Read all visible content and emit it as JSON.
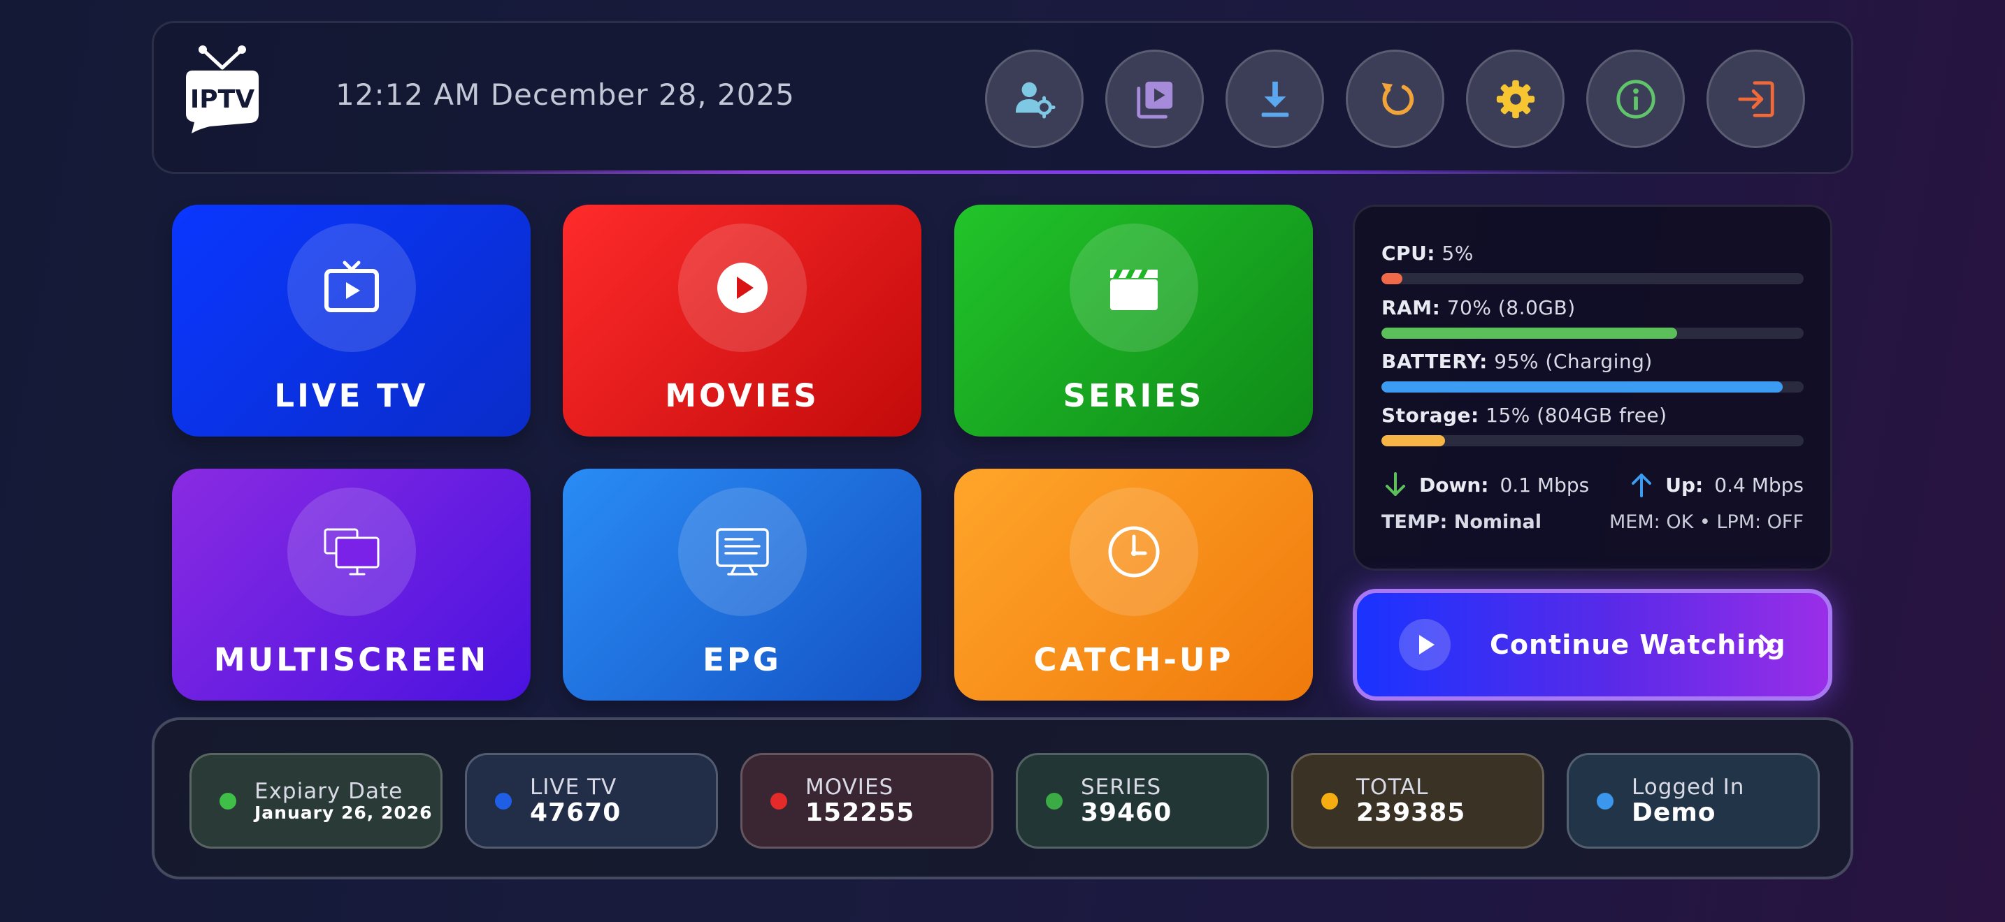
{
  "header": {
    "logo_text": "IPTV",
    "datetime": "12:12 AM December 28, 2025",
    "icon_buttons": [
      {
        "icon": "user-settings-icon",
        "color": "#7ec8e3"
      },
      {
        "icon": "playlist-icon",
        "color": "#a78bdb"
      },
      {
        "icon": "download-icon",
        "color": "#5aa8ef"
      },
      {
        "icon": "refresh-icon",
        "color": "#f0a43a"
      },
      {
        "icon": "gear-icon",
        "color": "#f7c531"
      },
      {
        "icon": "info-icon",
        "color": "#5fc46a"
      },
      {
        "icon": "logout-icon",
        "color": "#ef6a3a"
      }
    ]
  },
  "tiles": {
    "live_tv": {
      "label": "LIVE TV",
      "icon": "tv-icon",
      "color": "#0a37ff"
    },
    "movies": {
      "label": "MOVIES",
      "icon": "play-circle-icon",
      "color": "#e81c1c"
    },
    "series": {
      "label": "SERIES",
      "icon": "clapperboard-icon",
      "color": "#1eb526"
    },
    "multiscreen": {
      "label": "MULTISCREEN",
      "icon": "monitors-icon",
      "color": "#7a22e8"
    },
    "epg": {
      "label": "EPG",
      "icon": "tv-guide-icon",
      "color": "#2477e8"
    },
    "catchup": {
      "label": "CATCH-UP",
      "icon": "clock-icon",
      "color": "#fb921c"
    }
  },
  "stats": {
    "cpu": {
      "label": "CPU:",
      "value": "5%",
      "percent": 5,
      "color": "#f06a4a"
    },
    "ram": {
      "label": "RAM:",
      "value": "70% (8.0GB)",
      "percent": 70,
      "color": "#5cc05a"
    },
    "battery": {
      "label": "BATTERY:",
      "value": "95% (Charging)",
      "percent": 95,
      "color": "#3b9cf2"
    },
    "storage": {
      "label": "Storage:",
      "value": "15% (804GB free)",
      "percent": 15,
      "color": "#f7b546"
    },
    "down_label": "Down:",
    "down_value": "0.1 Mbps",
    "up_label": "Up:",
    "up_value": "0.4 Mbps",
    "temp_label": "TEMP:",
    "temp_value": "Nominal",
    "mem_status": "MEM: OK • LPM: OFF"
  },
  "continue_watching": {
    "label": "Continue Watching"
  },
  "footer": {
    "expiry": {
      "label": "Expiary Date",
      "value": "January 26, 2026",
      "dot": "#3fbf48"
    },
    "live_tv": {
      "label": "LIVE TV",
      "value": "47670",
      "dot": "#1f5fe6"
    },
    "movies": {
      "label": "MOVIES",
      "value": "152255",
      "dot": "#e52a2a"
    },
    "series": {
      "label": "SERIES",
      "value": "39460",
      "dot": "#3bab45"
    },
    "total": {
      "label": "TOTAL",
      "value": "239385",
      "dot": "#f6ad12"
    },
    "logged_in": {
      "label": "Logged In",
      "value": "Demo",
      "dot": "#3b97ee"
    }
  }
}
